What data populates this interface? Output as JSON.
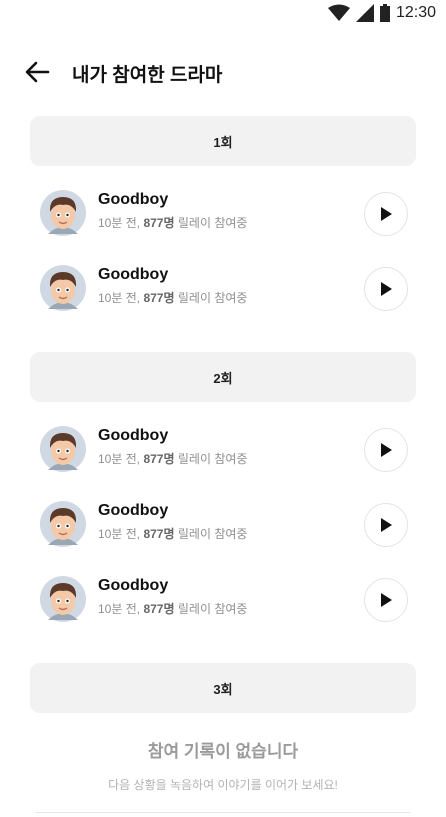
{
  "status": {
    "time": "12:30",
    "icons": [
      "wifi-icon",
      "signal-icon",
      "battery-icon"
    ]
  },
  "header": {
    "title": "내가 참여한 드라마",
    "back_icon": "arrow-left-icon"
  },
  "episodes": [
    {
      "label": "1회",
      "items": [
        {
          "title": "Goodboy",
          "time": "10분 전,",
          "count": "877명",
          "suffix": "릴레이 참여중"
        },
        {
          "title": "Goodboy",
          "time": "10분 전,",
          "count": "877명",
          "suffix": "릴레이 참여중"
        }
      ]
    },
    {
      "label": "2회",
      "items": [
        {
          "title": "Goodboy",
          "time": "10분 전,",
          "count": "877명",
          "suffix": "릴레이 참여중"
        },
        {
          "title": "Goodboy",
          "time": "10분 전,",
          "count": "877명",
          "suffix": "릴레이 참여중"
        },
        {
          "title": "Goodboy",
          "time": "10분 전,",
          "count": "877명",
          "suffix": "릴레이 참여중"
        }
      ]
    },
    {
      "label": "3회",
      "empty_title": "참여 기록이 없습니다",
      "empty_subtitle": "다음 상황을 녹음하여 이야기를 이어가 보세요!"
    }
  ],
  "colors": {
    "section_bg": "#f2f2f2",
    "muted_text": "#8f8f8f",
    "accent": "#111111"
  }
}
